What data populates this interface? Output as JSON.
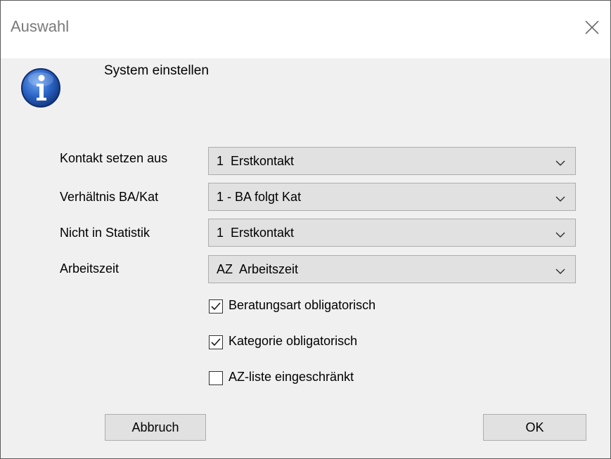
{
  "window": {
    "title": "Auswahl",
    "close_icon": "close-icon"
  },
  "message": {
    "icon": "info-icon",
    "heading": "System einstellen"
  },
  "fields": [
    {
      "label": "Kontakt setzen aus",
      "value": "1  Erstkontakt"
    },
    {
      "label": "Verhältnis BA/Kat",
      "value": "1 - BA folgt Kat"
    },
    {
      "label": "Nicht in Statistik",
      "value": "1  Erstkontakt"
    },
    {
      "label": "Arbeitszeit",
      "value": "AZ  Arbeitszeit"
    }
  ],
  "checkboxes": [
    {
      "label": "Beratungsart obligatorisch",
      "checked": true
    },
    {
      "label": "Kategorie obligatorisch",
      "checked": true
    },
    {
      "label": "AZ-liste eingeschränkt",
      "checked": false
    }
  ],
  "buttons": {
    "cancel": "Abbruch",
    "ok": "OK"
  },
  "colors": {
    "icon_blue": "#1f5fbf",
    "control_bg": "#e1e1e1",
    "control_border": "#adadad"
  }
}
